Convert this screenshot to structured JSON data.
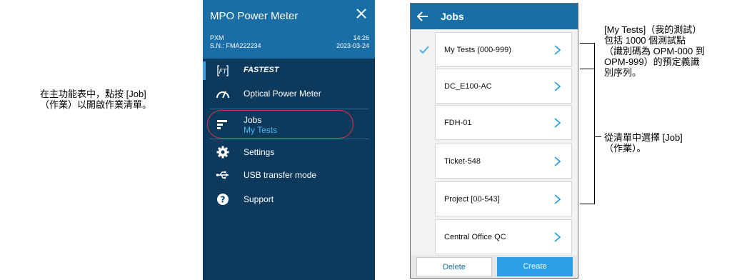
{
  "annotations": {
    "left": "在主功能表中，點按 [Job]\n（作業）以開啟作業清單。",
    "right_top": "[My Tests]（我的測試）\n包括 1000 個測試點\n（識別碼為 OPM-000 到\nOPM-999）的預定義識\n別序列。",
    "right_bottom": "從清單中選擇 [Job]\n（作業）。"
  },
  "main_menu": {
    "title": "MPO Power Meter",
    "device_model": "PXM",
    "serial": "S.N.: FMA222234",
    "time": "14:26",
    "date": "2023-03-24",
    "items": [
      {
        "label": "FASTEST",
        "icon": "fastest-icon"
      },
      {
        "label": "Optical Power Meter",
        "icon": "gauge-icon"
      },
      {
        "label": "Jobs",
        "sublabel": "My Tests",
        "icon": "jobs-icon"
      },
      {
        "label": "Settings",
        "icon": "gear-icon"
      },
      {
        "label": "USB transfer mode",
        "icon": "usb-icon"
      },
      {
        "label": "Support",
        "icon": "help-icon"
      }
    ]
  },
  "jobs_screen": {
    "title": "Jobs",
    "items": [
      {
        "name": "My Tests (000-999)",
        "selected": true
      },
      {
        "name": "DC_E100-AC",
        "selected": false
      },
      {
        "name": "FDH-01",
        "selected": false
      },
      {
        "name": "Ticket-548",
        "selected": false
      },
      {
        "name": "Project [00-543]",
        "selected": false
      },
      {
        "name": "Central Office QC",
        "selected": false
      }
    ],
    "delete_label": "Delete",
    "create_label": "Create"
  },
  "colors": {
    "header_blue": "#1a6ea6",
    "menu_dark": "#0d3a5c",
    "accent_blue": "#2a9fe6",
    "highlight_red": "#d9344a"
  }
}
